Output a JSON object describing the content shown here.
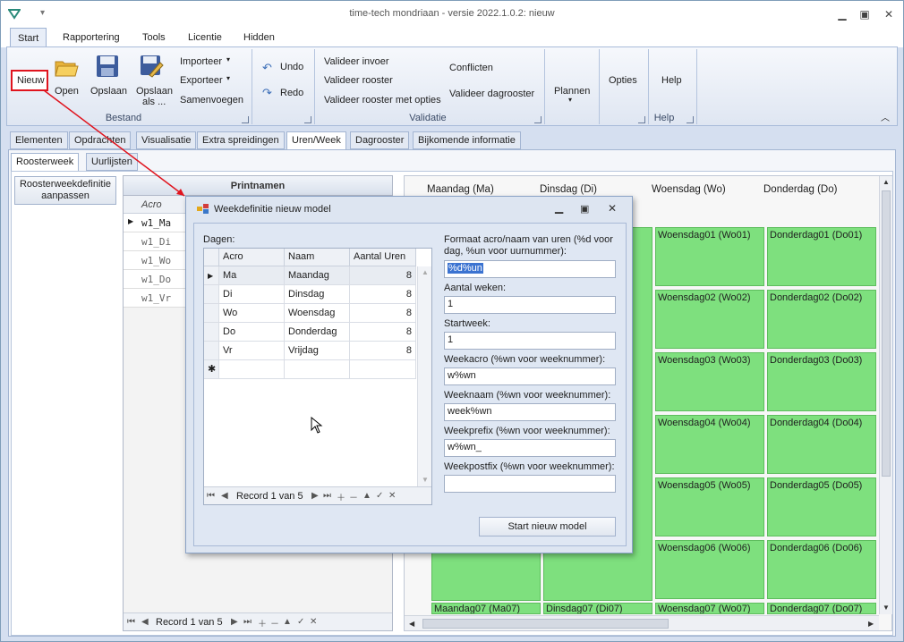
{
  "window": {
    "title": "time-tech mondriaan - versie 2022.1.0.2: nieuw",
    "qa_icon": "app-logo-icon",
    "qa_more": "▾"
  },
  "menu": [
    "Start",
    "Rapportering",
    "Tools",
    "Licentie",
    "Hidden"
  ],
  "ribbon": {
    "nieuw": "Nieuw",
    "open": "Open",
    "opslaan": "Opslaan",
    "opslaan_als_1": "Opslaan",
    "opslaan_als_2": "als ...",
    "importeer": "Importeer",
    "exporteer": "Exporteer",
    "samenvoegen": "Samenvoegen",
    "bestand": "Bestand",
    "undo": "Undo",
    "redo": "Redo",
    "valideer_invoer": "Valideer invoer",
    "valideer_rooster": "Valideer rooster",
    "valideer_rooster_opties": "Valideer rooster met opties",
    "conflicten": "Conflicten",
    "valideer_dagrooster": "Valideer dagrooster",
    "validatie": "Validatie",
    "plannen": "Plannen",
    "opties": "Opties",
    "help": "Help",
    "help_group": "Help"
  },
  "tabs": [
    "Elementen",
    "Opdrachten",
    "Visualisatie",
    "Extra spreidingen",
    "Uren/Week",
    "Dagrooster",
    "Bijkomende informatie"
  ],
  "subtabs": [
    "Roosterweek",
    "Uurlijsten"
  ],
  "left": {
    "button": [
      "Roosterweekdefinitie",
      "aanpassen"
    ]
  },
  "printnamen": {
    "header": "Printnamen",
    "col": "Acro",
    "rows": [
      "w1_Ma",
      "w1_Di",
      "w1_Wo",
      "w1_Do",
      "w1_Vr"
    ],
    "record": "Record 1 van 5"
  },
  "week": {
    "days": [
      "Maandag (Ma)",
      "Dinsdag (Di)",
      "Woensdag (Wo)",
      "Donderdag (Do)"
    ],
    "wo": [
      "Woensdag01 (Wo01)",
      "Woensdag02 (Wo02)",
      "Woensdag03 (Wo03)",
      "Woensdag04 (Wo04)",
      "Woensdag05 (Wo05)",
      "Woensdag06 (Wo06)",
      "Woensdag07 (Wo07)"
    ],
    "do": [
      "Donderdag01 (Do01)",
      "Donderdag02 (Do02)",
      "Donderdag03 (Do03)",
      "Donderdag04 (Do04)",
      "Donderdag05 (Do05)",
      "Donderdag06 (Do06)",
      "Donderdag07 (Do07)"
    ],
    "ma07": "Maandag07 (Ma07)",
    "di07": "Dinsdag07 (Di07)"
  },
  "dialog": {
    "title": "Weekdefinitie nieuw model",
    "dagen_label": "Dagen:",
    "columns": [
      "Acro",
      "Naam",
      "Aantal Uren"
    ],
    "rows": [
      {
        "acro": "Ma",
        "naam": "Maandag",
        "uren": "8"
      },
      {
        "acro": "Di",
        "naam": "Dinsdag",
        "uren": "8"
      },
      {
        "acro": "Wo",
        "naam": "Woensdag",
        "uren": "8"
      },
      {
        "acro": "Do",
        "naam": "Donderdag",
        "uren": "8"
      },
      {
        "acro": "Vr",
        "naam": "Vrijdag",
        "uren": "8"
      }
    ],
    "record": "Record 1 van 5",
    "format_label_1": "Formaat acro/naam van uren (%d voor",
    "format_label_2": "dag, %un voor uurnummer):",
    "format_value": "%d%un",
    "weken_label": "Aantal weken:",
    "weken_value": "1",
    "startweek_label": "Startweek:",
    "startweek_value": "1",
    "weekacro_label": "Weekacro (%wn voor weeknummer):",
    "weekacro_value": "w%wn",
    "weeknaam_label": "Weeknaam (%wn voor weeknummer):",
    "weeknaam_value": "week%wn",
    "weekprefix_label": "Weekprefix (%wn voor weeknummer):",
    "weekprefix_value": "w%wn_",
    "weekpostfix_label": "Weekpostfix (%wn voor weeknummer):",
    "weekpostfix_value": "",
    "start_button": "Start nieuw model"
  },
  "colors": {
    "accent_red": "#e0141e",
    "green_cell": "#7ee07e",
    "selection": "#3b73d1"
  }
}
